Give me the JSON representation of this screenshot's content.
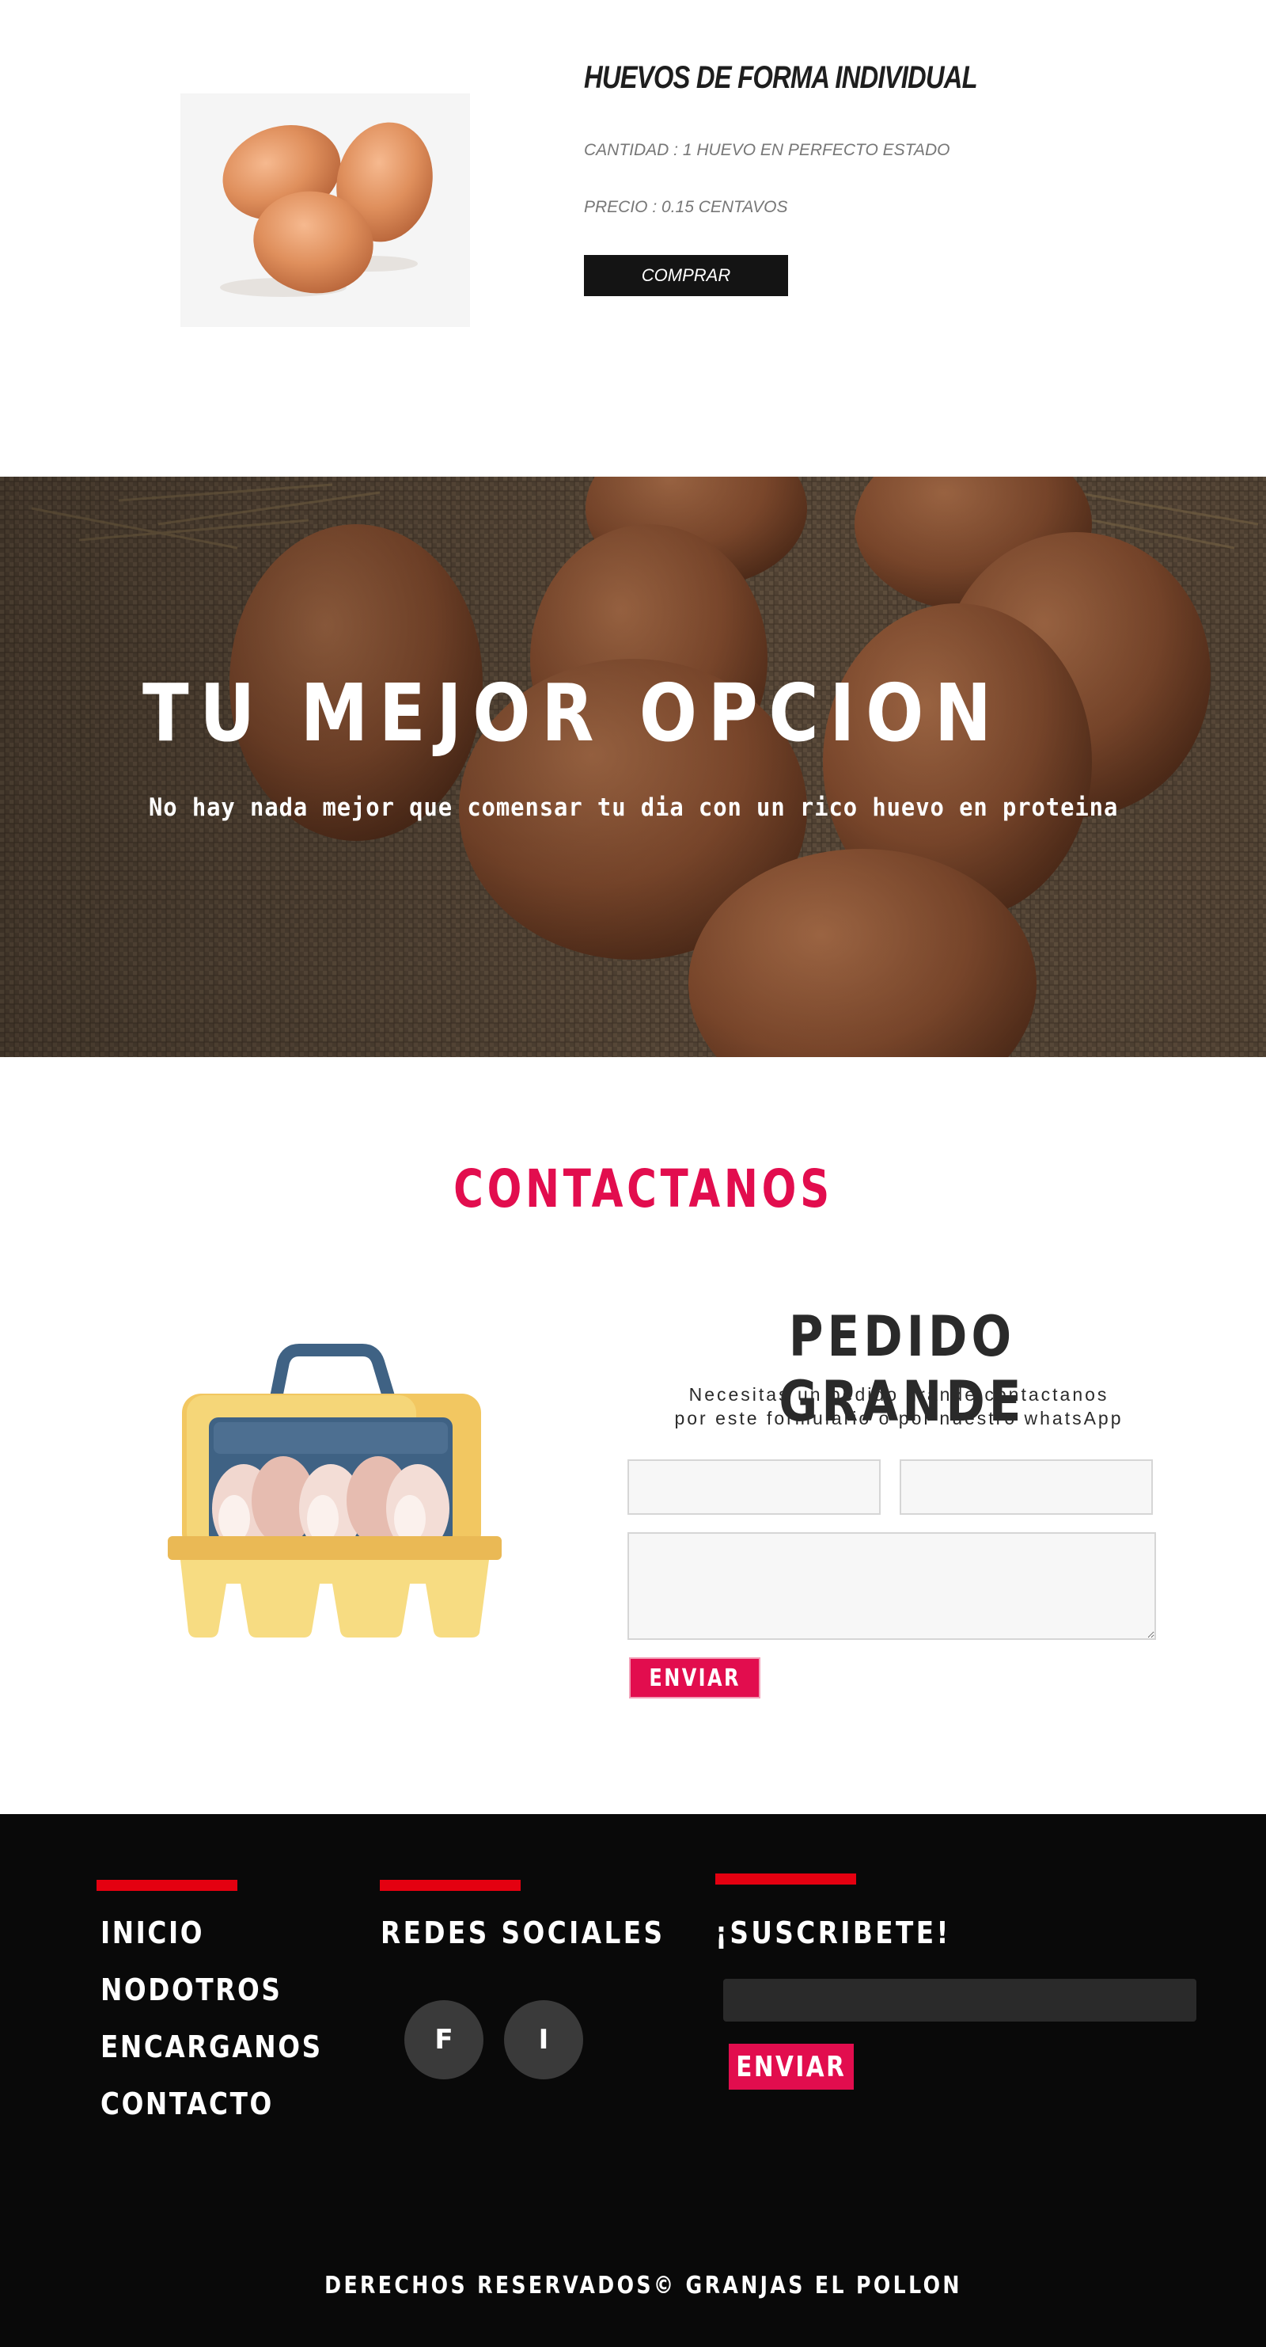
{
  "product": {
    "title": "HUEVOS DE FORMA INDIVIDUAL",
    "quantity": "CANTIDAD : 1 HUEVO EN PERFECTO ESTADO",
    "price": "PRECIO : 0.15 CENTAVOS",
    "buy_label": "COMPRAR",
    "image_icon": "eggs-photo"
  },
  "hero": {
    "title": "TU MEJOR OPCION",
    "subtitle": "No hay nada mejor que comensar tu dia con un rico huevo en proteina",
    "background_icon": "eggs-on-burlap-photo"
  },
  "contact": {
    "title": "CONTACTANOS",
    "illustration_icon": "egg-carton-icon",
    "form_title": "PEDIDO GRANDE",
    "form_desc_line1": "Necesitas un pedido grande contactanos",
    "form_desc_line2": "por este formulario o por nuestro whatsApp",
    "name_value": "",
    "email_value": "",
    "message_value": "",
    "send_label": "ENVIAR"
  },
  "footer": {
    "links": [
      "INICIO",
      "NODOTROS",
      "ENCARGANOS",
      "CONTACTO"
    ],
    "social_heading": "REDES SOCIALES",
    "social": [
      {
        "label": "F",
        "icon": "facebook-icon"
      },
      {
        "label": "I",
        "icon": "instagram-icon"
      }
    ],
    "subscribe_heading": "¡SUSCRIBETE!",
    "subscribe_value": "",
    "subscribe_label": "ENVIAR",
    "copyright": "DERECHOS RESERVADOS© GRANJAS EL POLLON"
  },
  "colors": {
    "accent": "#e20d4e",
    "footer_bar": "#e40010",
    "footer_bg": "#090909",
    "button_dark": "#141414"
  }
}
